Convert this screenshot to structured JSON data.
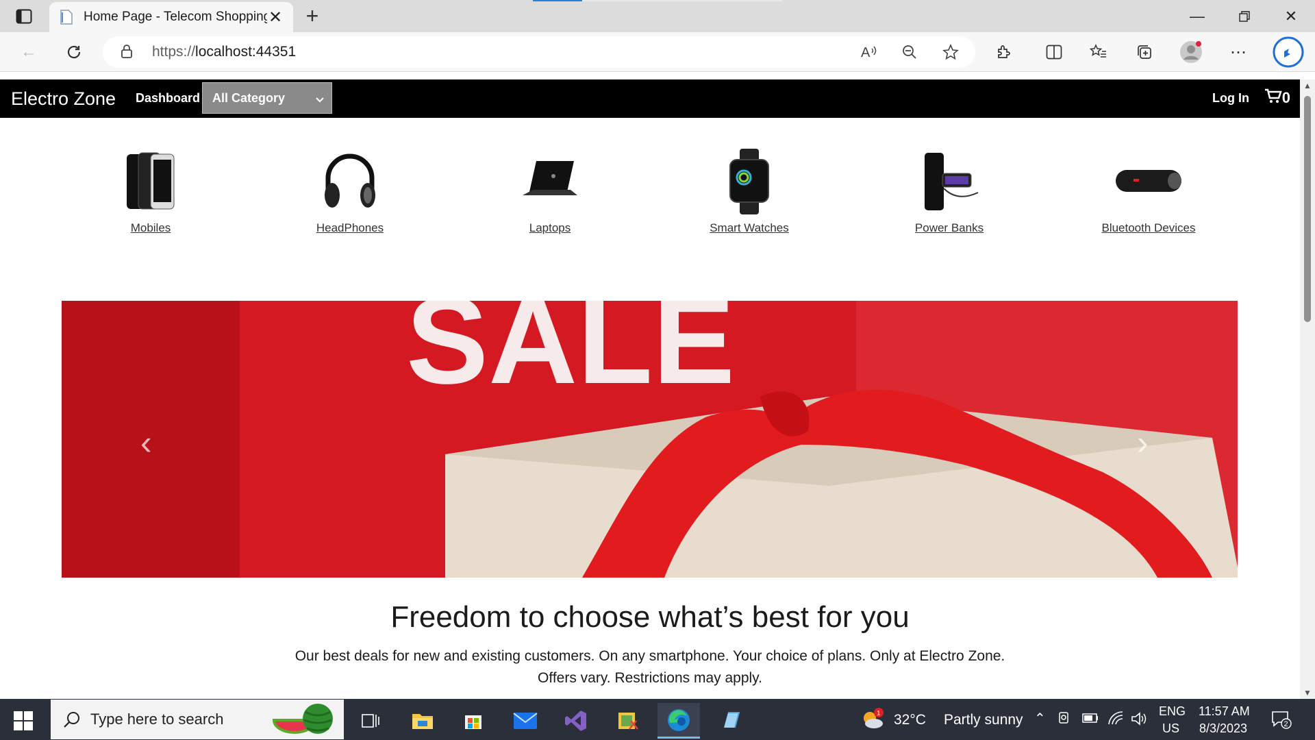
{
  "browser": {
    "tab_title": "Home Page - Telecom Shopping",
    "url_scheme": "https://",
    "url_host": "localhost:44351"
  },
  "site": {
    "brand": "Electro Zone",
    "nav_dashboard": "Dashboard",
    "category_select": "All Category",
    "login": "Log In",
    "cart_count": "0"
  },
  "categories": [
    {
      "label": "Mobiles",
      "icon": "phone"
    },
    {
      "label": "HeadPhones",
      "icon": "headphones"
    },
    {
      "label": "Laptops",
      "icon": "laptop"
    },
    {
      "label": "Smart Watches",
      "icon": "watch"
    },
    {
      "label": "Power Banks",
      "icon": "power-bank"
    },
    {
      "label": "Bluetooth Devices",
      "icon": "bluetooth-speaker"
    }
  ],
  "hero": {
    "banner_text": "SALE",
    "accent_color": "#d51922"
  },
  "promo": {
    "headline": "Freedom to choose what’s best for you",
    "line1": "Our best deals for new and existing customers. On any smartphone. Your choice of plans. Only at Electro Zone.",
    "line2": "Offers vary. Restrictions may apply."
  },
  "taskbar": {
    "search_placeholder": "Type here to search",
    "weather_temp": "32°C",
    "weather_text": "Partly sunny",
    "lang": "ENG",
    "region": "US",
    "time": "11:57 AM",
    "date": "8/3/2023",
    "notifications": "2",
    "weather_badge": "1"
  }
}
